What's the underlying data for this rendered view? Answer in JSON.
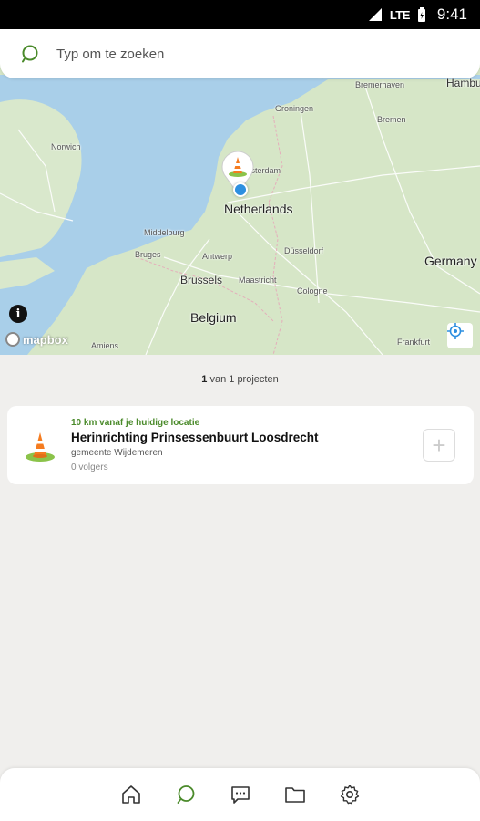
{
  "status_bar": {
    "network": "LTE",
    "time": "9:41"
  },
  "search": {
    "placeholder": "Typ om te zoeken"
  },
  "map": {
    "labels": {
      "groningen": "Groningen",
      "bremerhaven": "Bremerhaven",
      "hamburg": "Hambu",
      "bremen": "Bremen",
      "amsterdam": "Amsterdam",
      "netherlands": "Netherlands",
      "middelburg": "Middelburg",
      "dusseldorf": "Düsseldorf",
      "bruges": "Bruges",
      "antwerp": "Antwerp",
      "brussels": "Brussels",
      "maastricht": "Maastricht",
      "cologne": "Cologne",
      "germany": "Germany",
      "belgium": "Belgium",
      "norwich": "Norwich",
      "amiens": "Amiens",
      "frankfurt": "Frankfurt"
    },
    "attribution_logo": "mapbox",
    "info_label": "i"
  },
  "results": {
    "count_bold": "1",
    "count_rest": " van 1 projecten"
  },
  "project": {
    "distance": "10 km vanaf je huidige locatie",
    "title": "Herinrichting Prinsessenbuurt Loosdrecht",
    "organization": "gemeente Wijdemeren",
    "followers": "0 volgers",
    "add_label": "+"
  },
  "nav": {
    "items": [
      "home-icon",
      "search-icon",
      "chat-icon",
      "folder-icon",
      "settings-icon"
    ],
    "active": "search-icon"
  },
  "colors": {
    "accent": "#4a8a2a",
    "sea": "#a9cfe9",
    "land": "#d6e6c7",
    "user_dot": "#2d8fe0"
  }
}
